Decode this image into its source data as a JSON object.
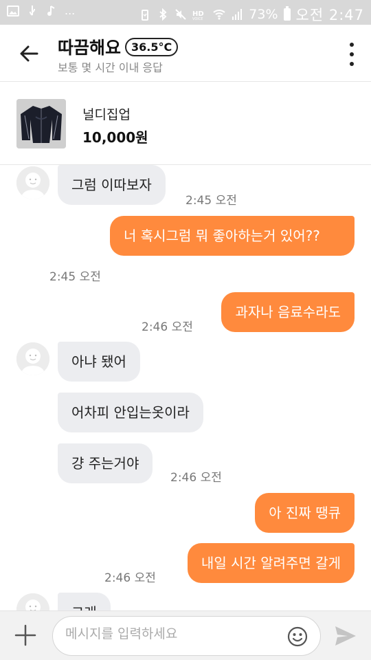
{
  "status_bar": {
    "battery": "73%",
    "time": "오전 2:47",
    "dots": "..."
  },
  "header": {
    "title": "따끔해요",
    "temperature": "36.5°C",
    "subtitle": "보통 몇 시간 이내 응답"
  },
  "product": {
    "name": "널디집업",
    "price": "10,000원"
  },
  "messages": [
    {
      "dir": "in",
      "text": "그럼 이따보자",
      "time": "2:45 오전"
    },
    {
      "dir": "out",
      "text": "너 혹시그럼 뭐 좋아하는거 있어??",
      "time": "2:45 오전"
    },
    {
      "dir": "out",
      "text": "과자나 음료수라도",
      "time": "2:46 오전"
    },
    {
      "dir": "in",
      "text": "아냐 됐어",
      "time": ""
    },
    {
      "dir": "in",
      "text": "어차피 안입는옷이라",
      "time": ""
    },
    {
      "dir": "in",
      "text": "걍 주는거야",
      "time": "2:46 오전"
    },
    {
      "dir": "out",
      "text": "아 진짜 땡큐",
      "time": ""
    },
    {
      "dir": "out",
      "text": "내일 시간 알려주면 갈게",
      "time": "2:46 오전"
    },
    {
      "dir": "in",
      "text": "그래",
      "time": ""
    }
  ],
  "input": {
    "placeholder": "메시지를 입력하세요",
    "value": ""
  },
  "colors": {
    "accent": "#ff8a3d",
    "incoming": "#ecedf0"
  },
  "icons": [
    "back-arrow-icon",
    "more-vert-icon",
    "plus-icon",
    "emoji-icon",
    "send-icon"
  ]
}
